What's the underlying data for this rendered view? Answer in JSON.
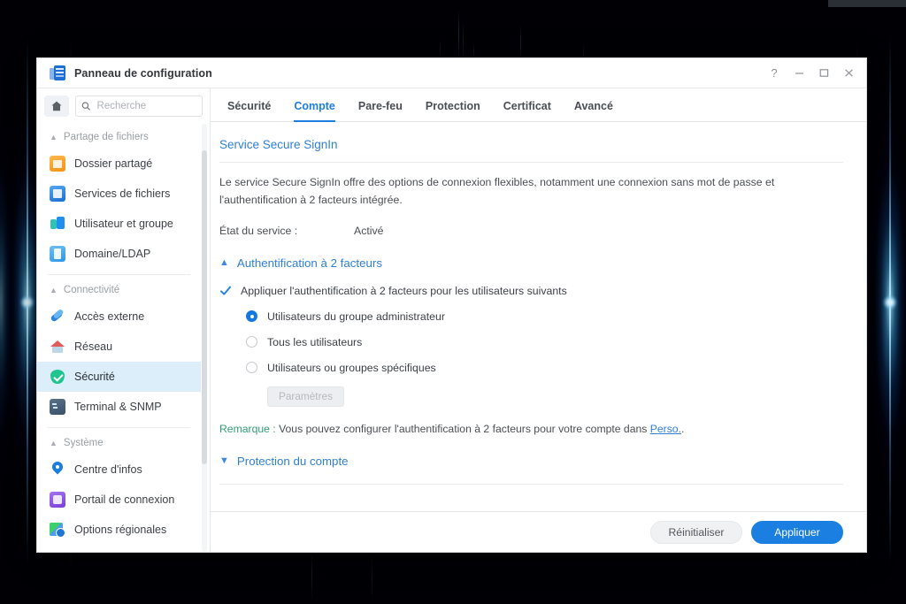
{
  "window": {
    "title": "Panneau de configuration",
    "icon": "control-panel-icon",
    "controls": {
      "help": "?",
      "minimize": "–",
      "maximize": "❐",
      "close": "×"
    }
  },
  "sidebar": {
    "home_icon": "home-icon",
    "search": {
      "placeholder": "Recherche",
      "value": "",
      "icon": "search-icon"
    },
    "groups": [
      {
        "label": "Partage de fichiers",
        "items": [
          {
            "label": "Dossier partagé",
            "icon": "shared-folder-icon",
            "active": false
          },
          {
            "label": "Services de fichiers",
            "icon": "file-services-icon",
            "active": false
          },
          {
            "label": "Utilisateur et groupe",
            "icon": "user-group-icon",
            "active": false
          },
          {
            "label": "Domaine/LDAP",
            "icon": "domain-ldap-icon",
            "active": false
          }
        ]
      },
      {
        "label": "Connectivité",
        "items": [
          {
            "label": "Accès externe",
            "icon": "external-access-icon",
            "active": false
          },
          {
            "label": "Réseau",
            "icon": "network-icon",
            "active": false
          },
          {
            "label": "Sécurité",
            "icon": "security-shield-icon",
            "active": true
          },
          {
            "label": "Terminal & SNMP",
            "icon": "terminal-snmp-icon",
            "active": false
          }
        ]
      },
      {
        "label": "Système",
        "items": [
          {
            "label": "Centre d'infos",
            "icon": "info-center-icon",
            "active": false
          },
          {
            "label": "Portail de connexion",
            "icon": "login-portal-icon",
            "active": false
          },
          {
            "label": "Options régionales",
            "icon": "regional-options-icon",
            "active": false
          }
        ]
      }
    ]
  },
  "tabs": [
    {
      "label": "Sécurité",
      "active": false
    },
    {
      "label": "Compte",
      "active": true
    },
    {
      "label": "Pare-feu",
      "active": false
    },
    {
      "label": "Protection",
      "active": false
    },
    {
      "label": "Certificat",
      "active": false
    },
    {
      "label": "Avancé",
      "active": false
    }
  ],
  "main": {
    "section_title": "Service Secure SignIn",
    "description": "Le service Secure SignIn offre des options de connexion flexibles, notamment une connexion sans mot de passe et l'authentification à 2 facteurs intégrée.",
    "service_state_label": "État du service :",
    "service_state_value": "Activé",
    "twofa": {
      "title": "Authentification à 2 facteurs",
      "expanded": true,
      "checkbox_label": "Appliquer l'authentification à 2 facteurs pour les utilisateurs suivants",
      "checkbox_checked": true,
      "options": [
        {
          "label": "Utilisateurs du groupe administrateur",
          "selected": true
        },
        {
          "label": "Tous les utilisateurs",
          "selected": false
        },
        {
          "label": "Utilisateurs ou groupes spécifiques",
          "selected": false
        }
      ],
      "settings_button": "Paramètres",
      "note_label": "Remarque :",
      "note_text": " Vous pouvez configurer l'authentification à 2 facteurs pour votre compte dans ",
      "note_link": "Perso.",
      "note_tail": "."
    },
    "account_protection": {
      "title": "Protection du compte",
      "expanded": false
    }
  },
  "footer": {
    "reset_label": "Réinitialiser",
    "apply_label": "Appliquer"
  },
  "colors": {
    "accent": "#1a7fe0",
    "link": "#2f7fd6",
    "note": "#2f9e74",
    "active_item_bg": "#ddeefb"
  }
}
